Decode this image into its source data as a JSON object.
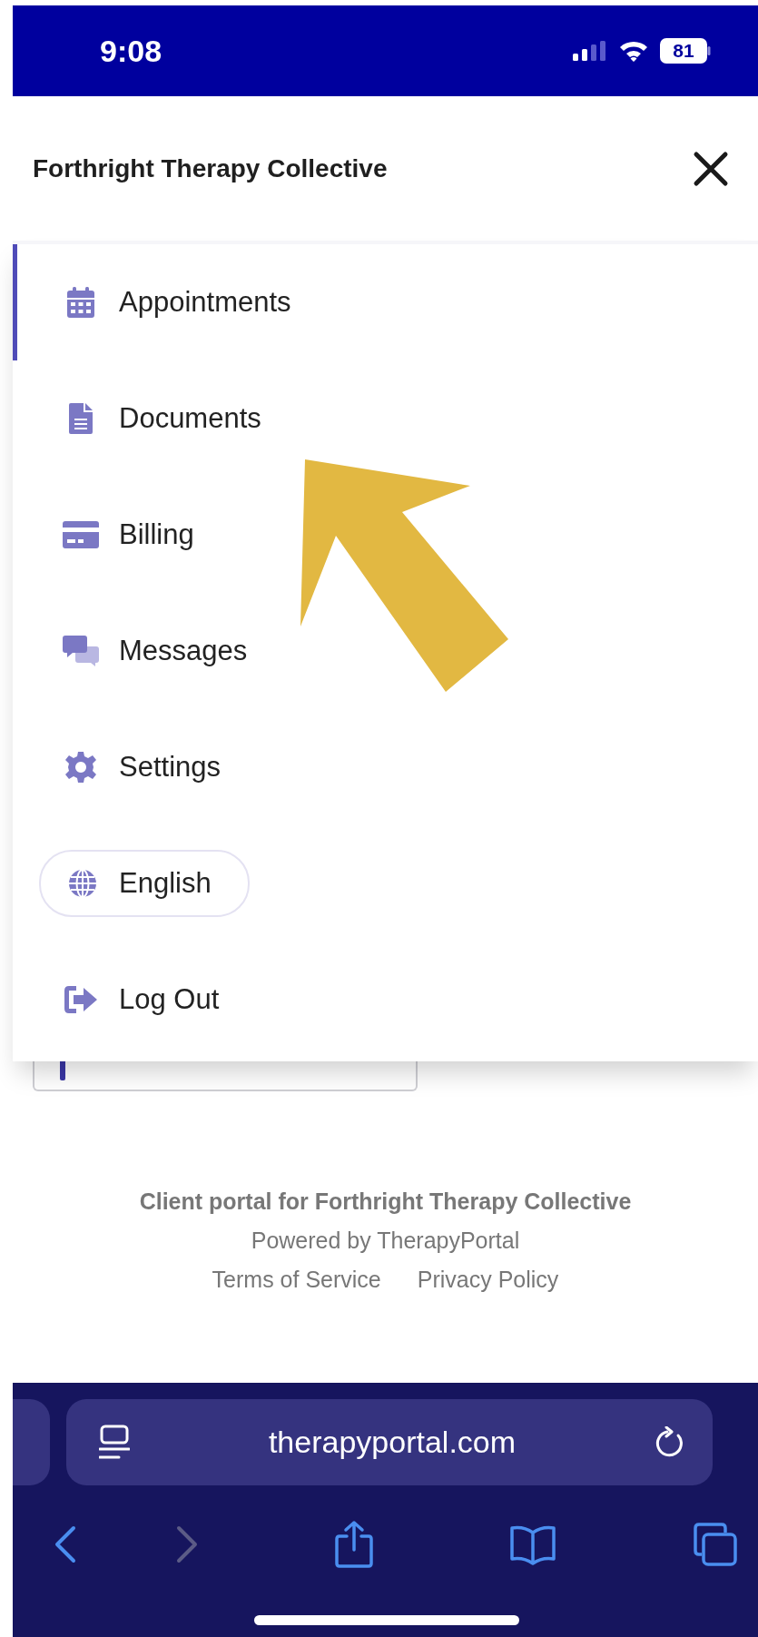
{
  "status_bar": {
    "time": "9:08",
    "battery": "81"
  },
  "header": {
    "title": "Forthright Therapy Collective"
  },
  "menu": {
    "items": [
      {
        "label": "Appointments",
        "kind": "link",
        "selected": true
      },
      {
        "label": "Documents",
        "kind": "link",
        "selected": false
      },
      {
        "label": "Billing",
        "kind": "link",
        "selected": false
      },
      {
        "label": "Messages",
        "kind": "link",
        "selected": false
      },
      {
        "label": "Settings",
        "kind": "link",
        "selected": false
      },
      {
        "label": "English",
        "kind": "language",
        "selected": false
      },
      {
        "label": "Log Out",
        "kind": "link",
        "selected": false
      }
    ]
  },
  "footer": {
    "portal": "Client portal for Forthright Therapy Collective",
    "powered": "Powered by TherapyPortal",
    "links": [
      "Terms of Service",
      "Privacy Policy"
    ]
  },
  "browser": {
    "url": "therapyportal.com",
    "back": {
      "disabled": false
    },
    "forward": {
      "disabled": true
    }
  }
}
